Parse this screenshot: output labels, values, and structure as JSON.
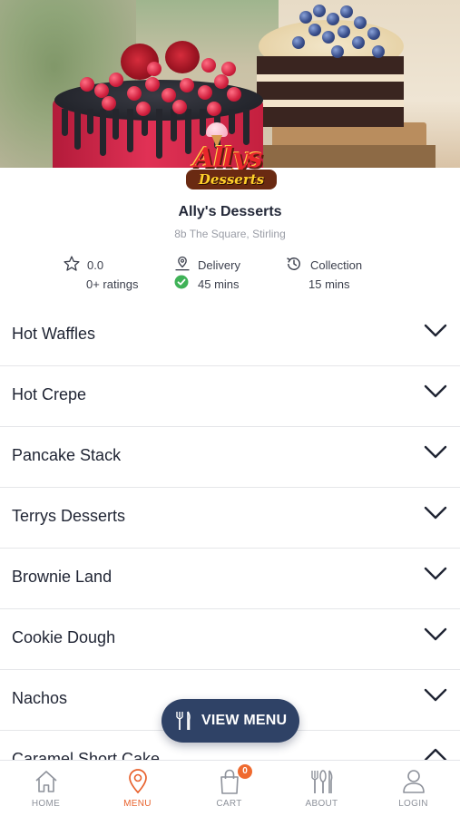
{
  "shop": {
    "name": "Ally's Desserts",
    "address": "8b The Square, Stirling",
    "logo_word1": "Allys",
    "logo_word2": "Desserts"
  },
  "stats": {
    "rating": {
      "value": "0.0",
      "count_label": "0+ ratings",
      "icon": "star-icon"
    },
    "delivery": {
      "label": "Delivery",
      "time": "45 mins",
      "icon": "delivery-pin-icon",
      "status_icon": "check-circle-icon",
      "status_color": "#3fb257"
    },
    "collection": {
      "label": "Collection",
      "time": "15 mins",
      "icon": "clock-history-icon"
    }
  },
  "menu": {
    "categories": [
      {
        "label": "Hot Waffles",
        "expanded": false
      },
      {
        "label": "Hot Crepe",
        "expanded": false
      },
      {
        "label": "Pancake Stack",
        "expanded": false
      },
      {
        "label": "Terrys Desserts",
        "expanded": false
      },
      {
        "label": "Brownie Land",
        "expanded": false
      },
      {
        "label": "Cookie Dough",
        "expanded": false
      },
      {
        "label": "Nachos",
        "expanded": false
      },
      {
        "label": "Caramel Short Cake",
        "expanded": true
      }
    ]
  },
  "view_menu_button": {
    "label": "VIEW MENU",
    "icon": "cutlery-icon",
    "color": "#2f4266"
  },
  "bottom_nav": {
    "items": [
      {
        "label": "HOME",
        "icon": "home-icon",
        "active": false
      },
      {
        "label": "MENU",
        "icon": "location-pin-icon",
        "active": true
      },
      {
        "label": "CART",
        "icon": "shopping-bag-icon",
        "active": false,
        "badge": "0"
      },
      {
        "label": "ABOUT",
        "icon": "cutlery-icon",
        "active": false
      },
      {
        "label": "LOGIN",
        "icon": "user-icon",
        "active": false
      }
    ]
  },
  "colors": {
    "accent": "#e8612c",
    "primary_dark": "#2f4266",
    "text": "#1f2433",
    "muted": "#9a9da6"
  }
}
